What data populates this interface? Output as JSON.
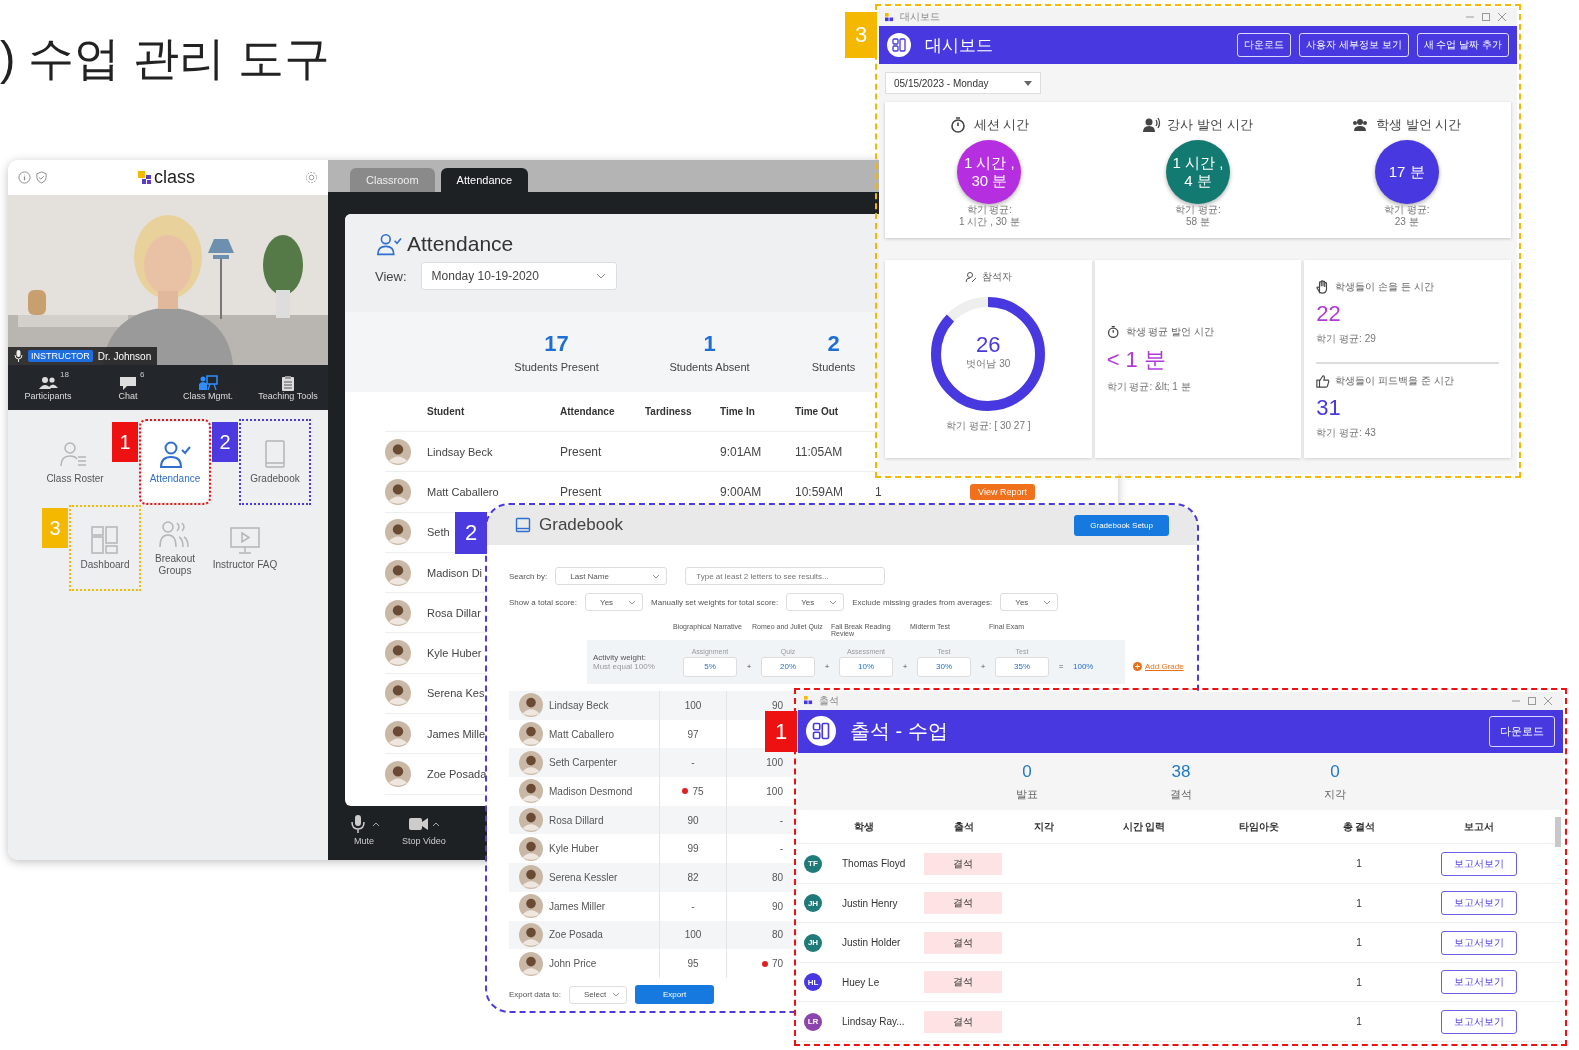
{
  "heading": ") 수업 관리 도구",
  "app": {
    "logo": "class",
    "video": {
      "kind": "picture",
      "role_badge": "INSTRUCTOR",
      "speaker": "Dr. Johnson"
    },
    "toolbar": [
      {
        "label": "Participants",
        "count": "18",
        "selected": false
      },
      {
        "label": "Chat",
        "count": "6",
        "selected": false
      },
      {
        "label": "Class Mgmt.",
        "selected": true
      },
      {
        "label": "Teaching Tools",
        "selected": false
      }
    ],
    "tools": [
      {
        "label": "Class Roster",
        "selected": false
      },
      {
        "label": "Attendance",
        "selected": true,
        "callout": {
          "label": "1",
          "color": "#ee1111"
        }
      },
      {
        "label": "Gradebook",
        "selected": false,
        "callout": {
          "label": "2",
          "color": "#4a3ae0"
        }
      },
      {
        "label": "Dashboard",
        "selected": false,
        "callout": {
          "label": "3",
          "color": "#f5b800"
        }
      },
      {
        "label": "Breakout Groups",
        "selected": false
      },
      {
        "label": "Instructor FAQ",
        "selected": false
      }
    ],
    "tabs": [
      {
        "label": "Classroom",
        "selected": false
      },
      {
        "label": "Attendance",
        "selected": true
      }
    ],
    "attendance": {
      "title": "Attendance",
      "view_label": "View:",
      "view_value": "Monday 10-19-2020",
      "stats": [
        {
          "value": "17",
          "label": "Students Present"
        },
        {
          "value": "1",
          "label": "Students Absent"
        },
        {
          "value": "2",
          "label": "Students"
        }
      ],
      "columns": [
        "Student",
        "Attendance",
        "Tardiness",
        "Time In",
        "Time Out"
      ],
      "rows": [
        {
          "name": "Lindsay Beck",
          "attendance": "Present",
          "time_in": "9:01AM",
          "time_out": "11:05AM"
        },
        {
          "name": "Matt Caballero",
          "attendance": "Present",
          "time_in": "9:00AM",
          "time_out": "10:59AM",
          "column_6": "1",
          "report": "View Report"
        },
        {
          "name": "Seth"
        },
        {
          "name": "Madison Di"
        },
        {
          "name": "Rosa Dillar"
        },
        {
          "name": "Kyle Huber"
        },
        {
          "name": "Serena Kes"
        },
        {
          "name": "James Mille"
        },
        {
          "name": "Zoe Posada"
        }
      ]
    },
    "controls": [
      {
        "label": "Mute"
      },
      {
        "label": "Stop Video"
      }
    ]
  },
  "dashboard": {
    "callout": {
      "label": "3",
      "color": "#f5b800"
    },
    "window_title": "대시보드",
    "title": "대시보드",
    "buttons": [
      "다운로드",
      "사용자 세부정보 보기",
      "새 수업 날짜 추가"
    ],
    "date": "05/15/2023 - Monday",
    "stats": [
      {
        "label": "세션 시간",
        "value": "1 시간 , 30 분",
        "color": "#b52ee0",
        "avg_label": "학기 평균:",
        "avg_value": "1 시간 , 30 분"
      },
      {
        "label": "강사 발언 시간",
        "value": "1 시간 , 4 분",
        "color": "#127a70",
        "avg_label": "학기 평균:",
        "avg_value": "58 분"
      },
      {
        "label": "학생 발언 시간",
        "value": "17 분",
        "color": "#4838e0",
        "avg_label": "학기 평균:",
        "avg_value": "23 분"
      }
    ],
    "attendees": {
      "label": "참석자",
      "value": "26",
      "sub": "벗어남 30",
      "level": 0.87,
      "avg": "학기 평균: [ 30 27 ]"
    },
    "avg_speaking": {
      "label": "학생 평균 발언 시간",
      "value": "< 1 분",
      "avg": "학기 평균: &lt; 1 분"
    },
    "counts": [
      {
        "label": "학생들이 손을 든 시간",
        "value": "22",
        "color": "#b03ad8",
        "avg": "학기 평균: 29"
      },
      {
        "label": "학생들이 피드백을 준 시간",
        "value": "31",
        "color": "#4838e0",
        "avg": "학기 평균: 43"
      }
    ]
  },
  "gradebook": {
    "callout": {
      "label": "2",
      "color": "#4a3ae0"
    },
    "title": "Gradebook",
    "setup_button": "Gradebook Setup",
    "search_label": "Search by:",
    "search_by": "Last Name",
    "search_placeholder": "Type at least 2 letters to see results...",
    "options": [
      {
        "label": "Show a total score:",
        "value": "Yes"
      },
      {
        "label": "Manually set weights for total score:",
        "value": "Yes"
      },
      {
        "label": "Exclude missing grades from averages:",
        "value": "Yes"
      }
    ],
    "weight_label": "Activity weight:",
    "weight_hint": "Must equal 100%",
    "activities": [
      {
        "name": "Biographical Narrative",
        "type": "Assignment",
        "weight": "5%"
      },
      {
        "name": "Romeo and Juliet Quiz",
        "type": "Quiz",
        "weight": "20%"
      },
      {
        "name": "Fall Break Reading Review",
        "type": "Assessment",
        "weight": "10%"
      },
      {
        "name": "Midterm Test",
        "type": "Test",
        "weight": "30%"
      },
      {
        "name": "Final Exam",
        "type": "Test",
        "weight": "35%"
      }
    ],
    "plus": "+",
    "equals": "=",
    "total": "100%",
    "add_grade": "Add Grade",
    "rows": [
      {
        "name": "Lindsay Beck",
        "scores": [
          {
            "value": "100",
            "flagged": false
          },
          {
            "value": "90",
            "flagged": false
          }
        ]
      },
      {
        "name": "Matt Caballero",
        "scores": [
          {
            "value": "97",
            "flagged": false
          }
        ]
      },
      {
        "name": "Seth Carpenter",
        "scores": [
          {
            "value": "-",
            "flagged": false
          },
          {
            "value": "100",
            "flagged": false
          }
        ]
      },
      {
        "name": "Madison Desmond",
        "scores": [
          {
            "value": "75",
            "flagged": true
          },
          {
            "value": "100",
            "flagged": false
          }
        ]
      },
      {
        "name": "Rosa Dillard",
        "scores": [
          {
            "value": "90",
            "flagged": false
          },
          {
            "value": "-",
            "flagged": false
          }
        ]
      },
      {
        "name": "Kyle Huber",
        "scores": [
          {
            "value": "99",
            "flagged": false
          },
          {
            "value": "-",
            "flagged": false
          }
        ]
      },
      {
        "name": "Serena Kessler",
        "scores": [
          {
            "value": "82",
            "flagged": false
          },
          {
            "value": "80",
            "flagged": false
          }
        ]
      },
      {
        "name": "James Miller",
        "scores": [
          {
            "value": "-",
            "flagged": false
          },
          {
            "value": "90",
            "flagged": false
          }
        ]
      },
      {
        "name": "Zoe Posada",
        "scores": [
          {
            "value": "100",
            "flagged": false
          },
          {
            "value": "80",
            "flagged": false
          }
        ]
      },
      {
        "name": "John Price",
        "scores": [
          {
            "value": "95",
            "flagged": false
          },
          {
            "value": "70",
            "flagged": true
          }
        ]
      }
    ],
    "export_label": "Export data to:",
    "export_select": "Select",
    "export_button": "Export"
  },
  "attendance_window": {
    "callout": {
      "label": "1",
      "color": "#ee1111"
    },
    "window_title": "출석",
    "title": "출석 - 수업",
    "download": "다운로드",
    "stats": [
      {
        "value": "0",
        "label": "발표"
      },
      {
        "value": "38",
        "label": "결석"
      },
      {
        "value": "0",
        "label": "지각"
      }
    ],
    "columns": [
      "학생",
      "출석",
      "지각",
      "시간 입력",
      "타임아웃",
      "총 결석",
      "보고서"
    ],
    "rows": [
      {
        "initials": "TF",
        "color": "#1f7a7a",
        "name": "Thomas Floyd",
        "status": "결석",
        "total": "1",
        "report": "보고서보기"
      },
      {
        "initials": "JH",
        "color": "#1f7a7a",
        "name": "Justin Henry",
        "status": "결석",
        "total": "1",
        "report": "보고서보기"
      },
      {
        "initials": "JH",
        "color": "#1f7a7a",
        "name": "Justin Holder",
        "status": "결석",
        "total": "1",
        "report": "보고서보기"
      },
      {
        "initials": "HL",
        "color": "#4838e0",
        "name": "Huey Le",
        "status": "결석",
        "total": "1",
        "report": "보고서보기"
      },
      {
        "initials": "LR",
        "color": "#8e44ad",
        "name": "Lindsay Ray...",
        "status": "결석",
        "total": "1",
        "report": "보고서보기"
      }
    ]
  }
}
